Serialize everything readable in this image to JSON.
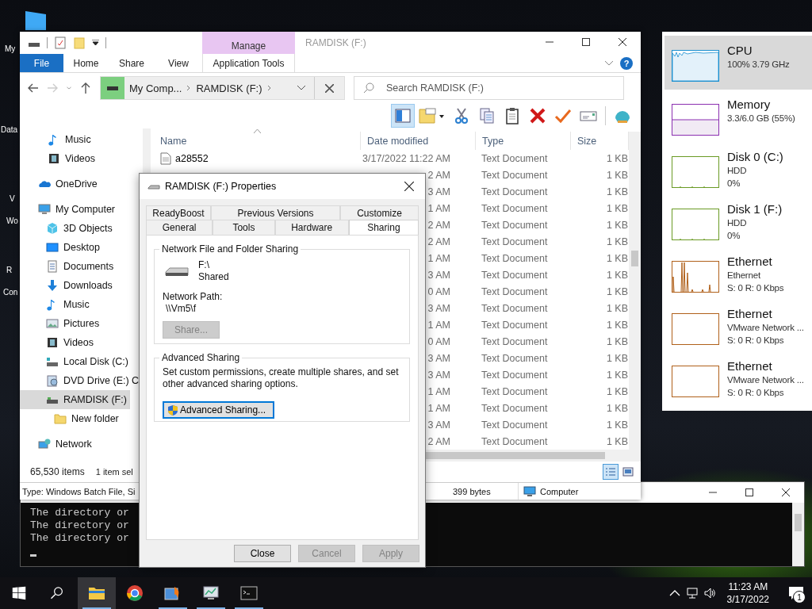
{
  "desktop_icons": [
    {
      "label_lines": [
        "My"
      ]
    },
    {
      "label_lines": [
        "Data"
      ]
    },
    {
      "label_lines": [
        "V",
        "Wo"
      ]
    },
    {
      "label_lines": [
        "R",
        "Con"
      ]
    }
  ],
  "cmd_window": {
    "lines": [
      "The directory or",
      "The directory or",
      "The directory or"
    ]
  },
  "explorer": {
    "title": "RAMDISK (F:)",
    "contextual_header": "Manage",
    "ribbon": {
      "file_tab": "File",
      "tabs": [
        "Home",
        "Share",
        "View"
      ],
      "contextual_tab": "Application Tools",
      "help_glyph": "?"
    },
    "address": {
      "crumbs": [
        "My Comp...",
        "RAMDISK (F:)"
      ]
    },
    "search": {
      "placeholder": "Search RAMDISK (F:)"
    },
    "toolbar": [
      {
        "kind": "preview-pane",
        "selected": true
      },
      {
        "kind": "new-folder",
        "selected": false
      },
      {
        "kind": "cut",
        "selected": false
      },
      {
        "kind": "copy",
        "selected": false
      },
      {
        "kind": "paste",
        "selected": false
      },
      {
        "kind": "delete",
        "selected": false
      },
      {
        "kind": "check",
        "selected": false
      },
      {
        "kind": "mail",
        "selected": false
      },
      {
        "kind": "shell",
        "selected": false
      }
    ],
    "nav_pane": {
      "partial_group": [
        {
          "label": "Music",
          "kind": "music",
          "selected": false
        },
        {
          "label": "Videos",
          "kind": "videos",
          "selected": false
        }
      ],
      "items": [
        {
          "label": "OneDrive",
          "kind": "cloud",
          "selected": false
        },
        {
          "label": "My Computer",
          "kind": "computer",
          "selected": false,
          "children": [
            {
              "label": "3D Objects",
              "kind": "cube",
              "selected": false
            },
            {
              "label": "Desktop",
              "kind": "desktop",
              "selected": false
            },
            {
              "label": "Documents",
              "kind": "documents",
              "selected": false
            },
            {
              "label": "Downloads",
              "kind": "downloads",
              "selected": false
            },
            {
              "label": "Music",
              "kind": "music",
              "selected": false
            },
            {
              "label": "Pictures",
              "kind": "pictures",
              "selected": false
            },
            {
              "label": "Videos",
              "kind": "videos",
              "selected": false
            },
            {
              "label": "Local Disk (C:)",
              "kind": "disk",
              "selected": false
            },
            {
              "label": "DVD Drive (E:) C",
              "kind": "dvd",
              "selected": false
            },
            {
              "label": "RAMDISK (F:)",
              "kind": "ramdisk",
              "selected": true,
              "children": [
                {
                  "label": "New folder",
                  "kind": "folder",
                  "selected": false
                }
              ]
            }
          ]
        },
        {
          "label": "Network",
          "kind": "network",
          "selected": false
        }
      ]
    },
    "columns": [
      "Name",
      "Date modified",
      "Type",
      "Size"
    ],
    "rows": [
      {
        "name": "a28552",
        "date_modified": "3/17/2022 11:22 AM",
        "type": "Text Document",
        "size": "1 KB"
      },
      {
        "date_modified": "2 AM",
        "type": "Text Document",
        "size": "1 KB"
      },
      {
        "date_modified": "3 AM",
        "type": "Text Document",
        "size": "1 KB"
      },
      {
        "date_modified": "1 AM",
        "type": "Text Document",
        "size": "1 KB"
      },
      {
        "date_modified": "2 AM",
        "type": "Text Document",
        "size": "1 KB"
      },
      {
        "date_modified": "2 AM",
        "type": "Text Document",
        "size": "1 KB"
      },
      {
        "date_modified": "1 AM",
        "type": "Text Document",
        "size": "1 KB"
      },
      {
        "date_modified": "3 AM",
        "type": "Text Document",
        "size": "1 KB"
      },
      {
        "date_modified": "0 AM",
        "type": "Text Document",
        "size": "1 KB"
      },
      {
        "date_modified": "3 AM",
        "type": "Text Document",
        "size": "1 KB"
      },
      {
        "date_modified": "1 AM",
        "type": "Text Document",
        "size": "1 KB"
      },
      {
        "date_modified": "0 AM",
        "type": "Text Document",
        "size": "1 KB"
      },
      {
        "date_modified": "3 AM",
        "type": "Text Document",
        "size": "1 KB"
      },
      {
        "date_modified": "3 AM",
        "type": "Text Document",
        "size": "1 KB"
      },
      {
        "date_modified": "1 AM",
        "type": "Text Document",
        "size": "1 KB"
      },
      {
        "date_modified": "1 AM",
        "type": "Text Document",
        "size": "1 KB"
      },
      {
        "date_modified": "3 AM",
        "type": "Text Document",
        "size": "1 KB"
      },
      {
        "date_modified": "2 AM",
        "type": "Text Document",
        "size": "1 KB"
      }
    ],
    "status_bar": {
      "item_count": "65,530 items",
      "selection": "1 item sel",
      "view_buttons": [
        {
          "kind": "details",
          "selected": true
        },
        {
          "kind": "large-icons",
          "selected": false
        }
      ]
    },
    "details_bar": {
      "type": "Type: Windows Batch File, Si",
      "size": "399 bytes",
      "location": "Computer"
    }
  },
  "properties_dialog": {
    "title": "RAMDISK (F:) Properties",
    "tab_rows": [
      [
        {
          "label": "ReadyBoost",
          "selected": false
        },
        {
          "label": "Previous Versions",
          "selected": false
        },
        {
          "label": "Customize",
          "selected": false
        }
      ],
      [
        {
          "label": "General",
          "selected": false
        },
        {
          "label": "Tools",
          "selected": false
        },
        {
          "label": "Hardware",
          "selected": false
        },
        {
          "label": "Sharing",
          "selected": true
        }
      ]
    ],
    "network_sharing": {
      "title": "Network File and Folder Sharing",
      "path": "F:\\",
      "status": "Shared",
      "network_path_label": "Network Path:",
      "network_path": "\\\\Vm5\\f",
      "button": {
        "label": "Share...",
        "disabled": true
      }
    },
    "advanced_sharing": {
      "title": "Advanced Sharing",
      "description": "Set custom permissions, create multiple shares, and set other advanced sharing options.",
      "button": {
        "label": "Advanced Sharing...",
        "disabled": false
      }
    },
    "buttons": [
      {
        "label": "Close",
        "disabled": false
      },
      {
        "label": "Cancel",
        "disabled": true
      },
      {
        "label": "Apply",
        "disabled": true
      }
    ]
  },
  "performance_panel": {
    "items": [
      {
        "title": "CPU",
        "lines": [
          "100% 3.79 GHz"
        ],
        "color": "#1a8fd0",
        "kind": "cpu",
        "selected": true
      },
      {
        "title": "Memory",
        "lines": [
          "3.3/6.0 GB (55%)"
        ],
        "color": "#8b2fb0",
        "kind": "memory",
        "selected": false
      },
      {
        "title": "Disk 0 (C:)",
        "lines": [
          "HDD",
          "0%"
        ],
        "color": "#6a9a24",
        "kind": "disk",
        "selected": false
      },
      {
        "title": "Disk 1 (F:)",
        "lines": [
          "HDD",
          "0%"
        ],
        "color": "#6a9a24",
        "kind": "disk",
        "selected": false
      },
      {
        "title": "Ethernet",
        "lines": [
          "Ethernet",
          "S: 0 R: 0 Kbps"
        ],
        "color": "#b0601a",
        "kind": "network-active",
        "selected": false
      },
      {
        "title": "Ethernet",
        "lines": [
          "VMware Network ...",
          "S: 0 R: 0 Kbps"
        ],
        "color": "#b0601a",
        "kind": "network",
        "selected": false
      },
      {
        "title": "Ethernet",
        "lines": [
          "VMware Network ...",
          "S: 0 R: 0 Kbps"
        ],
        "color": "#b0601a",
        "kind": "network",
        "selected": false
      }
    ]
  },
  "taskbar": {
    "apps": [
      {
        "kind": "file-explorer",
        "active": true,
        "running": true
      },
      {
        "kind": "browser",
        "active": false,
        "running": false
      },
      {
        "kind": "app-a",
        "active": false,
        "running": true
      },
      {
        "kind": "app-b",
        "active": false,
        "running": true
      },
      {
        "kind": "terminal",
        "active": false,
        "running": true
      }
    ],
    "clock": {
      "time": "11:23 AM",
      "date": "3/17/2022"
    },
    "notification_count": "1"
  }
}
